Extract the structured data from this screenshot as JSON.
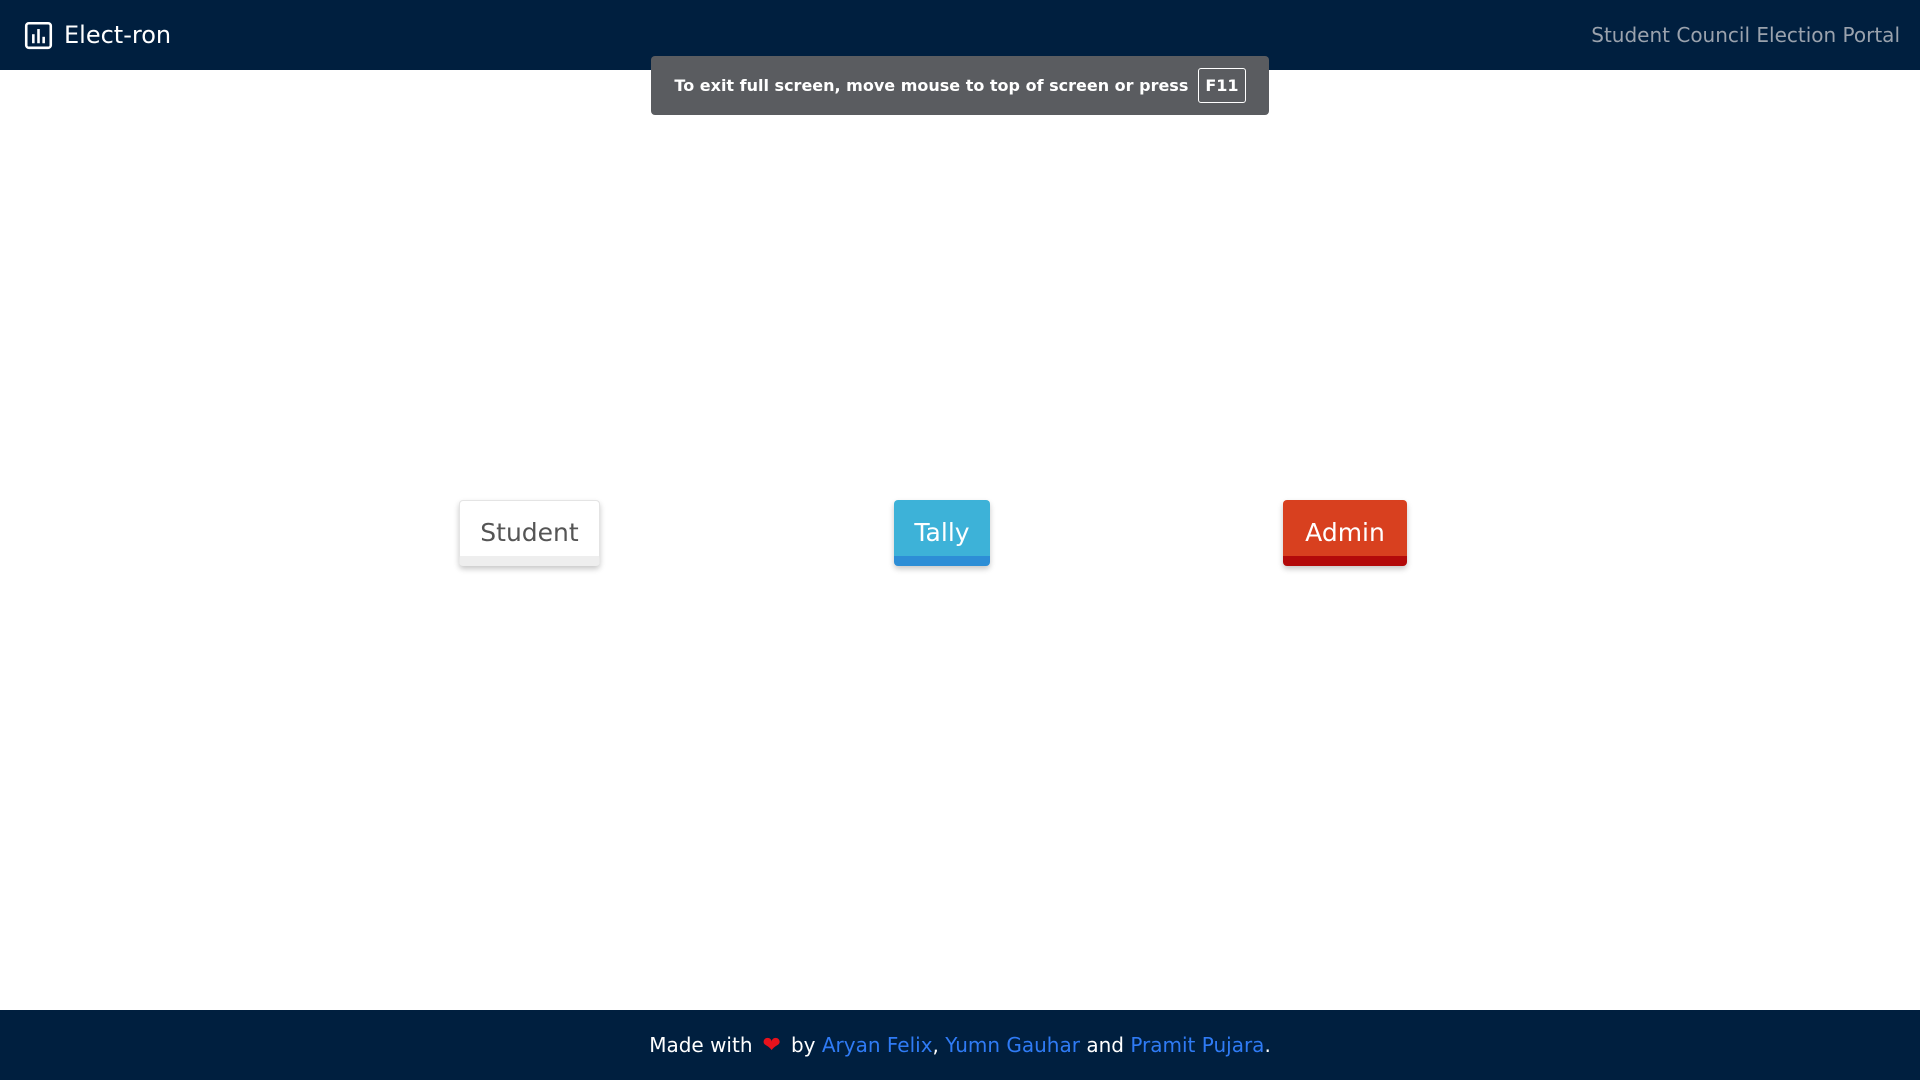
{
  "navbar": {
    "brand": "Elect-ron",
    "brand_icon": "bar-chart-icon",
    "portal_title": "Student Council Election Portal",
    "background": "#001f3f"
  },
  "fullscreen_notice": {
    "text": "To exit full screen, move mouse to top of screen or press",
    "key": "F11"
  },
  "choices": {
    "student": "Student",
    "tally": "Tally",
    "admin": "Admin"
  },
  "colors": {
    "tally": "#3db2d8",
    "admin": "#d8401f",
    "link": "#2f7bf5"
  },
  "footer": {
    "made_with": "Made with",
    "heart": "❤",
    "by": "by",
    "authors": [
      "Aryan Felix",
      "Yumn Gauhar",
      "Pramit Pujara"
    ],
    "sep_comma": ",",
    "and": "and",
    "period": "."
  }
}
